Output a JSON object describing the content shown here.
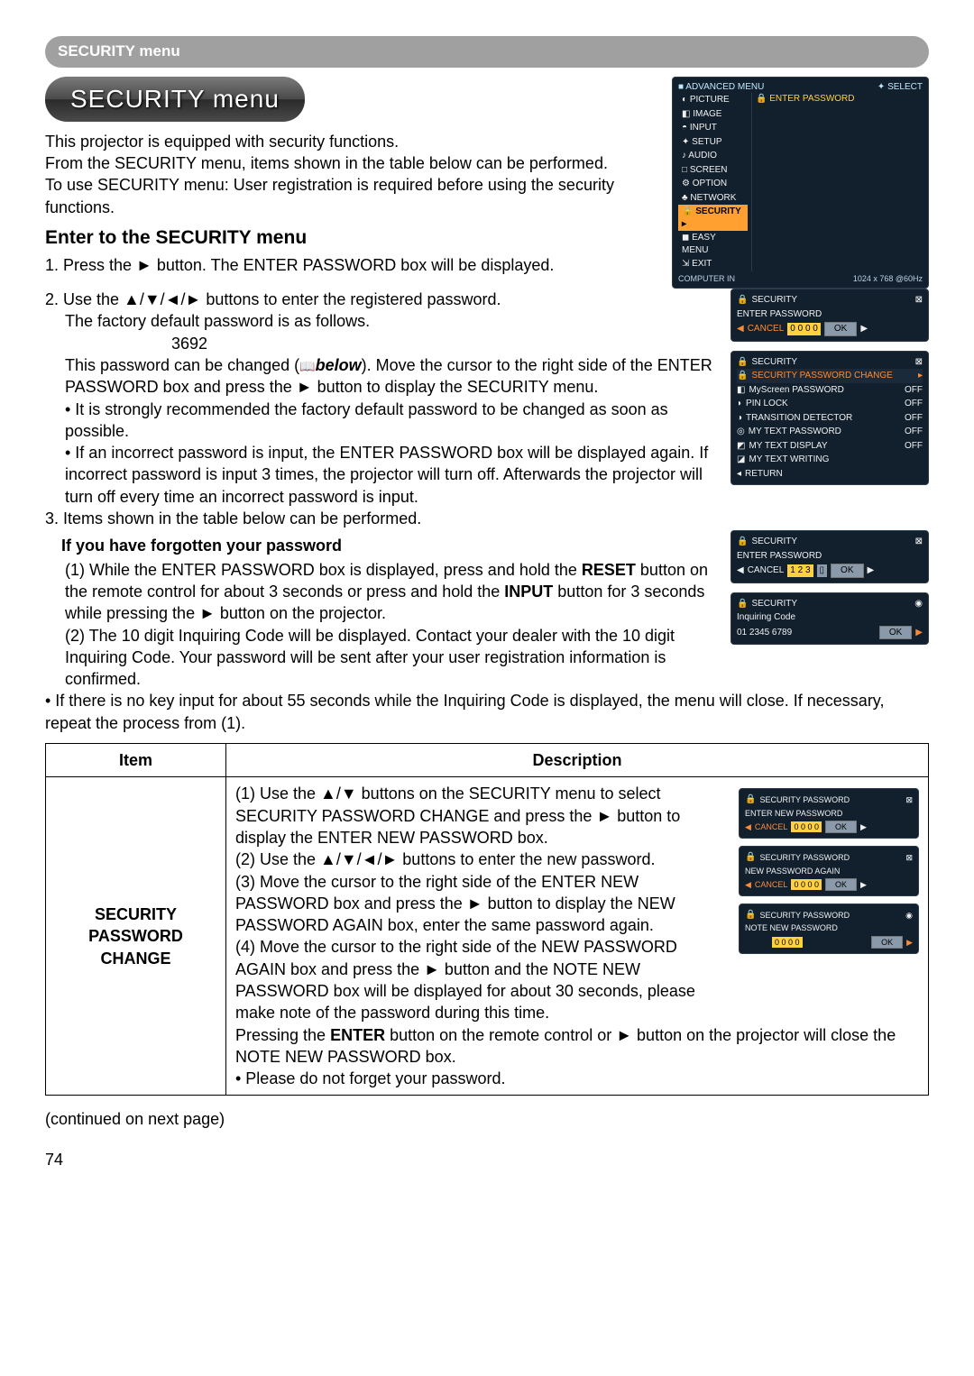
{
  "label_bar": "SECURITY menu",
  "heading": "SECURITY menu",
  "intro1": "This projector is equipped with security functions.",
  "intro2": "From the SECURITY menu, items shown in the table below can be performed.",
  "intro3": "To use SECURITY menu: User registration is required before using the security functions.",
  "enter_heading": "Enter to the SECURITY menu",
  "step1": "1. Press the ► button. The ENTER PASSWORD box will be displayed.",
  "step2": "2. Use the ▲/▼/◄/► buttons to enter the registered password.",
  "step2a": "The factory default password is as follows.",
  "default_password": "3692",
  "step2b_pre": "This password can be changed (",
  "step2b_below": "below",
  "step2b_post": "). Move the cursor to the right side of the ENTER PASSWORD box and press the ► button to display the SECURITY menu.",
  "bullet1": "• It is strongly recommended the factory default password to be changed as soon as possible.",
  "bullet2": "• If an incorrect password is input, the ENTER PASSWORD box will be displayed again. If incorrect password is input 3 times, the projector will turn off. Afterwards the projector will turn off every time an incorrect password is input.",
  "step3": "3. Items shown in the table below can be performed.",
  "forgot_heading": "If you have forgotten your password",
  "forgot1_pre": "(1) While the ENTER PASSWORD box is displayed, press and hold the ",
  "forgot1_reset": "RESET",
  "forgot1_mid": " button on the remote control for about 3 seconds or press and hold the ",
  "forgot1_input": "INPUT",
  "forgot1_post": " button for 3 seconds while pressing the ► button on the projector.",
  "forgot2": "(2) The 10 digit Inquiring Code will be displayed. Contact your dealer with the 10 digit Inquiring Code. Your password will be sent after your user registration information is confirmed.",
  "forgot_note": "• If there is no key input for about 55 seconds while the Inquiring Code is displayed, the menu will close. If necessary, repeat the process from (1).",
  "table_h1": "Item",
  "table_h2": "Description",
  "item1": "SECURITY PASSWORD CHANGE",
  "d1": "(1) Use the ▲/▼ buttons on the SECURITY menu to select SECURITY PASSWORD CHANGE and press the ► button to display the ENTER NEW PASSWORD box.",
  "d2": "(2) Use the ▲/▼/◄/► buttons to enter the new password.",
  "d3": "(3) Move the cursor to the right side of the ENTER NEW PASSWORD box and press the ► button to display the NEW PASSWORD AGAIN box, enter the same password again.",
  "d4_pre": "(4) Move the cursor to the right side of the NEW PASSWORD AGAIN box and press the ► button and the NOTE NEW PASSWORD box will be displayed for about 30 seconds, please make note of the password during this time.",
  "d4_post_pre": "Pressing the ",
  "d4_enter": "ENTER",
  "d4_post_post": " button on the remote control or ► button on the projector will close the NOTE NEW PASSWORD box.",
  "d_bullet": "• Please do not forget your password.",
  "continued": "(continued on next page)",
  "pagenum": "74",
  "osd_advanced": {
    "title": "ADVANCED MENU",
    "select": "SELECT",
    "items": [
      "PICTURE",
      "IMAGE",
      "INPUT",
      "SETUP",
      "AUDIO",
      "SCREEN",
      "OPTION",
      "NETWORK",
      "SECURITY",
      "EASY MENU",
      "EXIT"
    ],
    "right_label": "ENTER PASSWORD",
    "foot_left": "COMPUTER IN",
    "foot_right": "1024 x 768 @60Hz"
  },
  "osd_enterpw": {
    "title": "SECURITY",
    "sub": "ENTER PASSWORD",
    "cancel": "CANCEL",
    "vals": "0 0 0 0",
    "ok": "OK"
  },
  "osd_secmenu": {
    "title": "SECURITY",
    "change": "SECURITY PASSWORD CHANGE",
    "rows": [
      {
        "label": "MyScreen PASSWORD",
        "val": "OFF"
      },
      {
        "label": "PIN LOCK",
        "val": "OFF"
      },
      {
        "label": "TRANSITION DETECTOR",
        "val": "OFF"
      },
      {
        "label": "MY TEXT PASSWORD",
        "val": "OFF"
      },
      {
        "label": "MY TEXT DISPLAY",
        "val": "OFF"
      },
      {
        "label": "MY TEXT WRITING",
        "val": ""
      }
    ],
    "return": "RETURN"
  },
  "osd_enter123": {
    "title": "SECURITY",
    "sub": "ENTER PASSWORD",
    "cancel": "CANCEL",
    "vals": "1 2 3",
    "ok": "OK"
  },
  "osd_inq": {
    "title": "SECURITY",
    "sub": "Inquiring Code",
    "code": "01 2345 6789",
    "ok": "OK"
  },
  "osd_new": {
    "title": "SECURITY PASSWORD",
    "sub": "ENTER NEW PASSWORD",
    "cancel": "CANCEL",
    "vals": "0 0 0 0",
    "ok": "OK"
  },
  "osd_again": {
    "title": "SECURITY PASSWORD",
    "sub": "NEW PASSWORD AGAIN",
    "cancel": "CANCEL",
    "vals": "0 0 0 0",
    "ok": "OK"
  },
  "osd_note": {
    "title": "SECURITY PASSWORD",
    "sub": "NOTE NEW PASSWORD",
    "vals": "0 0 0 0",
    "ok": "OK"
  }
}
